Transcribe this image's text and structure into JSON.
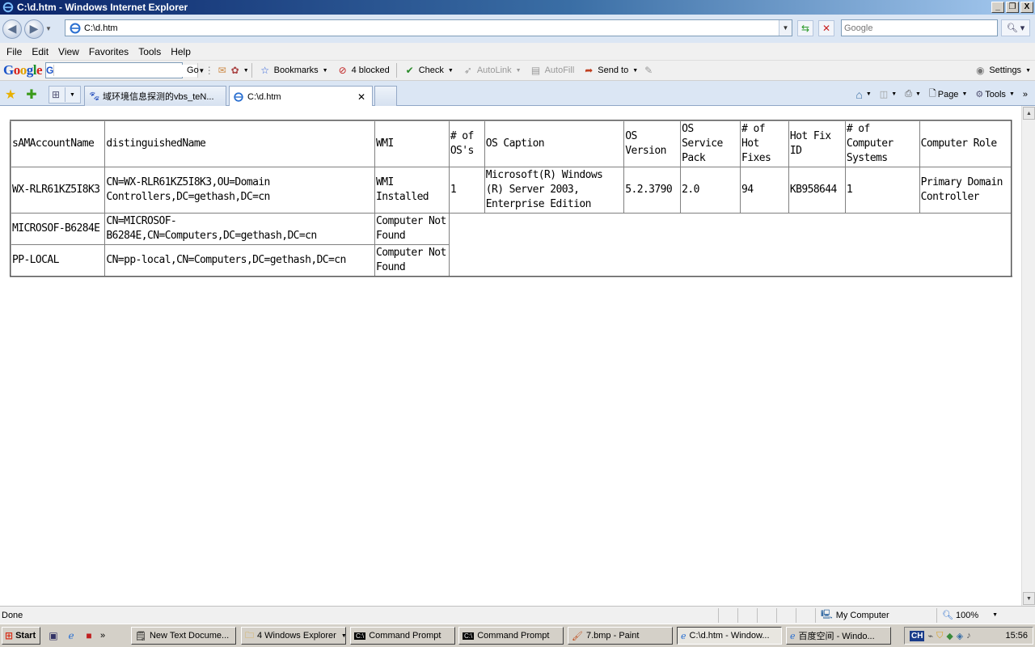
{
  "window": {
    "title": "C:\\d.htm - Windows Internet Explorer",
    "min_label": "_",
    "max_label": "❐",
    "close_label": "X"
  },
  "address": {
    "url": "C:\\d.htm",
    "search_placeholder": "Google"
  },
  "menu": {
    "items": [
      "File",
      "Edit",
      "View",
      "Favorites",
      "Tools",
      "Help"
    ]
  },
  "google_toolbar": {
    "logo": [
      "G",
      "o",
      "o",
      "g",
      "l",
      "e"
    ],
    "search_mark": "G",
    "go_label": "Go",
    "bookmarks_label": "Bookmarks",
    "blocked_label": "4 blocked",
    "check_label": "Check",
    "autolink_label": "AutoLink",
    "autofill_label": "AutoFill",
    "sendto_label": "Send to",
    "settings_label": "Settings"
  },
  "tabs": [
    {
      "label": "域环境信息探测的vbs_teN..."
    },
    {
      "label": "C:\\d.htm"
    }
  ],
  "command_bar": {
    "page_label": "Page",
    "tools_label": "Tools"
  },
  "table": {
    "header": [
      "sAMAccountName",
      "distinguishedName",
      "WMI",
      "# of OS's",
      "OS Caption",
      "OS Version",
      "OS Service Pack",
      "# of Hot Fixes",
      "Hot Fix ID",
      "# of Computer Systems",
      "Computer Role"
    ],
    "rows": [
      [
        "WX-RLR61KZ5I8K3",
        "CN=WX-RLR61KZ5I8K3,OU=Domain Controllers,DC=gethash,DC=cn",
        "WMI Installed",
        "1",
        "Microsoft(R) Windows (R) Server 2003, Enterprise Edition",
        "5.2.3790",
        "2.0",
        "94",
        "KB958644",
        "1",
        "Primary Domain Controller"
      ],
      [
        "MICROSOF-B6284E",
        "CN=MICROSOF-B6284E,CN=Computers,DC=gethash,DC=cn",
        "Computer Not Found"
      ],
      [
        "PP-LOCAL",
        "CN=pp-local,CN=Computers,DC=gethash,DC=cn",
        "Computer Not Found"
      ]
    ]
  },
  "status": {
    "text": "Done",
    "zone": "My Computer",
    "zoom": "100%"
  },
  "taskbar": {
    "start_label": "Start",
    "more_label": "»",
    "tasks": [
      "New Text Docume...",
      "4 Windows Explorer",
      "Command Prompt",
      "Command Prompt",
      "7.bmp - Paint",
      "C:\\d.htm - Window...",
      "百度空间 - Windo..."
    ],
    "lang": "CH",
    "clock": "15:56"
  },
  "colors": {
    "titlebar_start": "#0a246a",
    "titlebar_end": "#a6caf0",
    "chrome_bg": "#dbe6f4",
    "taskbar_bg": "#d4d0c8"
  }
}
